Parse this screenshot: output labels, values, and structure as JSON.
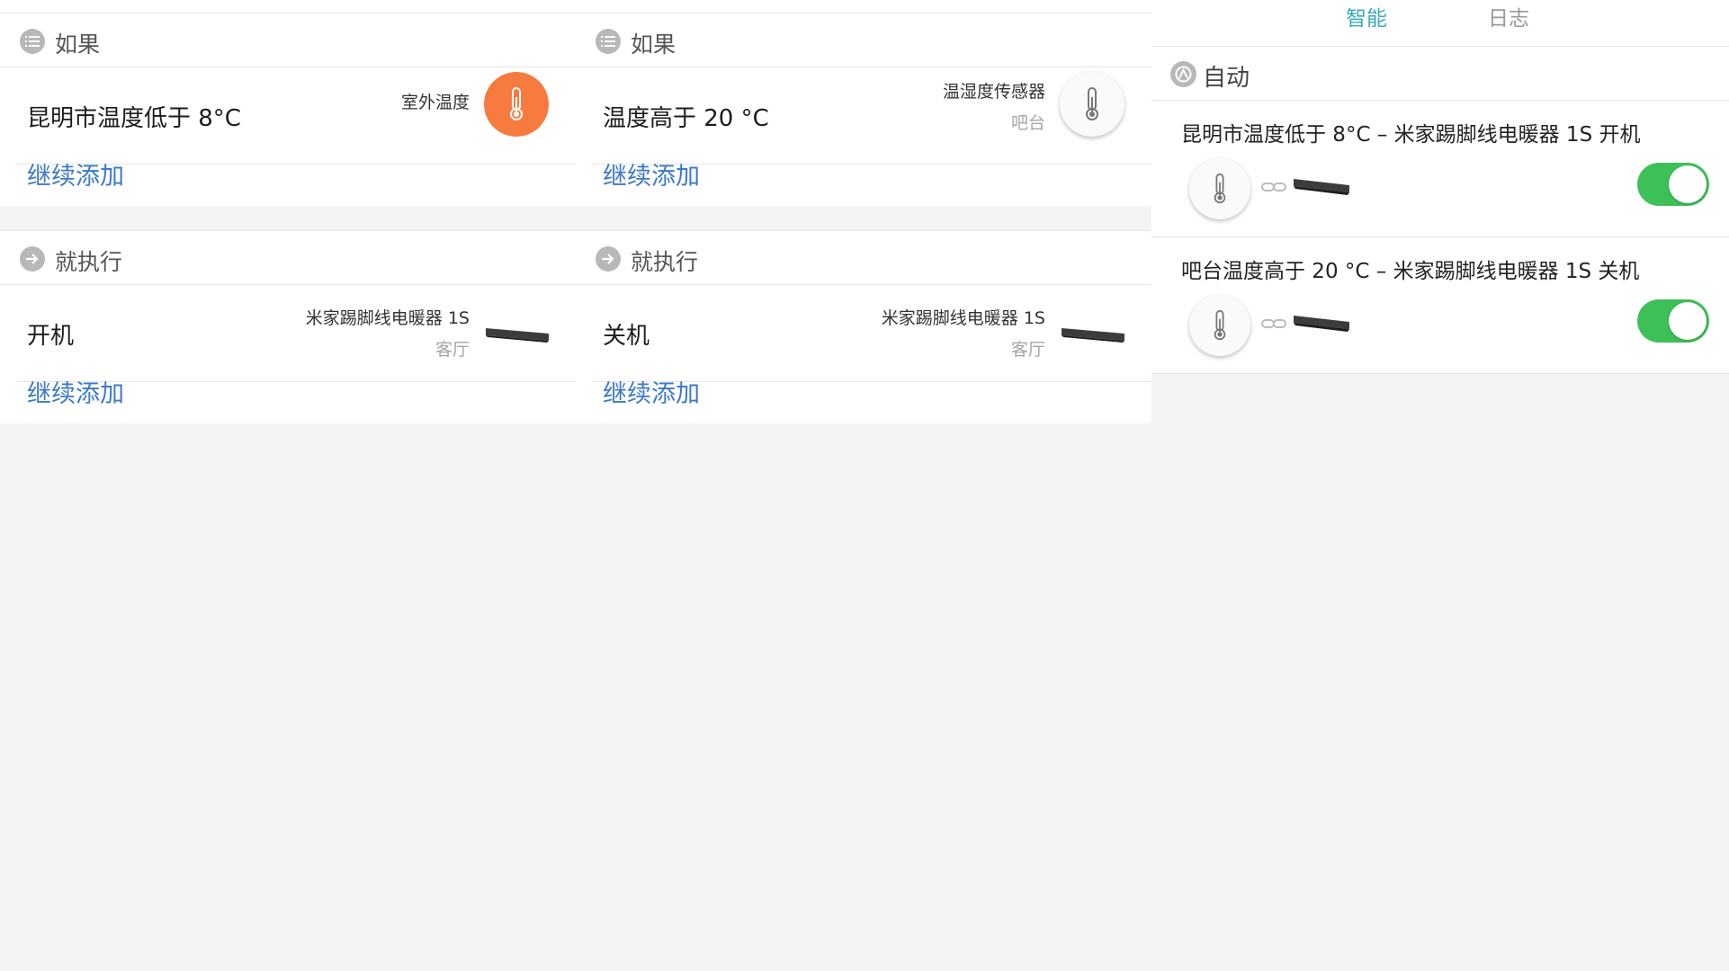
{
  "panel1": {
    "if_header": "如果",
    "condition": {
      "main": "昆明市温度低于 8°C",
      "source": "室外温度",
      "icon": "thermometer-icon"
    },
    "add_condition": "继续添加",
    "then_header": "就执行",
    "action": {
      "main": "开机",
      "device": "米家踢脚线电暖器 1S",
      "room": "客厅",
      "icon": "heater-icon"
    },
    "add_action": "继续添加"
  },
  "panel2": {
    "if_header": "如果",
    "condition": {
      "main": "温度高于 20 °C",
      "device": "温湿度传感器",
      "room": "吧台",
      "icon": "thermometer-icon"
    },
    "add_condition": "继续添加",
    "then_header": "就执行",
    "action": {
      "main": "关机",
      "device": "米家踢脚线电暖器 1S",
      "room": "客厅",
      "icon": "heater-icon"
    },
    "add_action": "继续添加"
  },
  "panel3": {
    "tabs": [
      {
        "label": "智能",
        "active": true
      },
      {
        "label": "日志",
        "active": false
      }
    ],
    "auto_header": "自动",
    "rules": [
      {
        "title": "昆明市温度低于 8°C – 米家踢脚线电暖器 1S 开机",
        "enabled": true
      },
      {
        "title": "吧台温度高于 20 °C – 米家踢脚线电暖器 1S 关机",
        "enabled": true
      }
    ]
  },
  "colors": {
    "accent_orange": "#f77b3f",
    "link_blue": "#3c79c8",
    "tab_active": "#3aaab9",
    "toggle_on": "#3ec059"
  }
}
